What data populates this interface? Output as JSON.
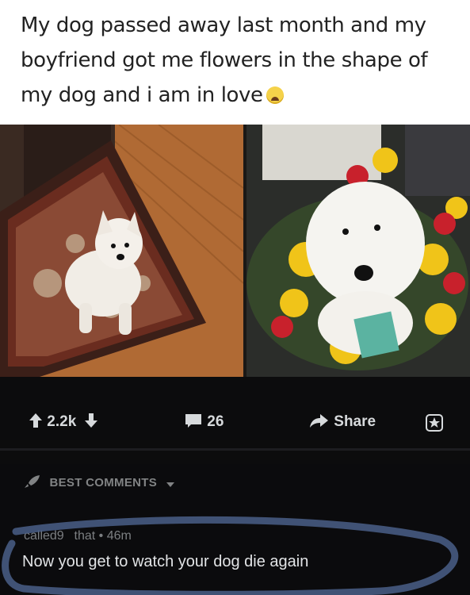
{
  "caption": {
    "text": "My dog passed away last month and my boyfriend got me flowers in the shape of my dog and i am in love",
    "emoji_icon": "crying-face-emoji"
  },
  "photos": {
    "left": "white dog on rug",
    "right": "dog-shaped flower arrangement"
  },
  "action_bar": {
    "upvote_count": "2.2k",
    "comment_count": "26",
    "share_label": "Share"
  },
  "comments": {
    "sort_label": "BEST COMMENTS",
    "items": [
      {
        "author_and_time": "called9    that • 46m",
        "body": "Now you get to watch your dog die again"
      }
    ]
  },
  "colors": {
    "background": "#0b0b0d",
    "text_muted": "#818384",
    "scribble": "#4a5f88"
  }
}
